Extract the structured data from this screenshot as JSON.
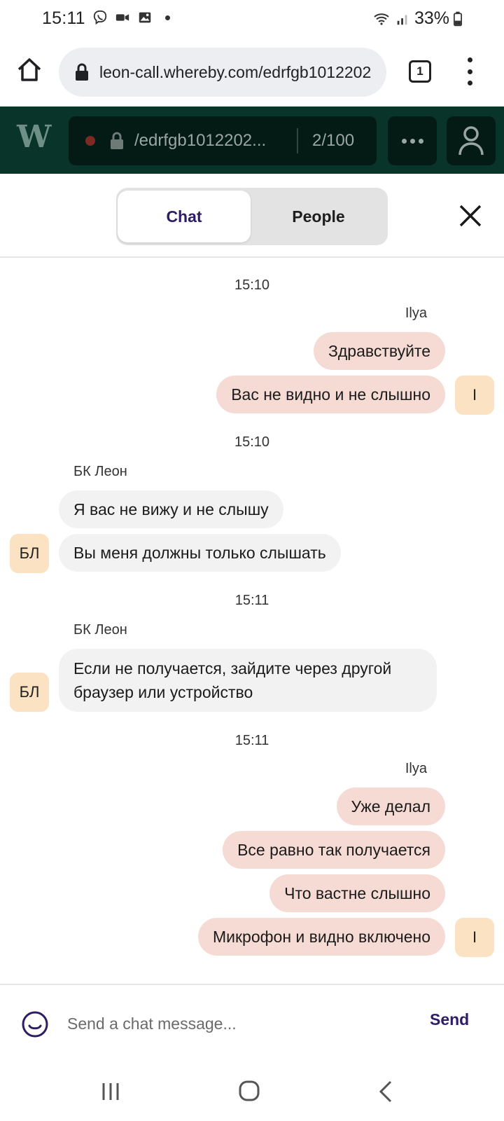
{
  "status_bar": {
    "time": "15:11",
    "icons": [
      "viber-icon",
      "video-icon",
      "image-icon",
      "notification-dot"
    ],
    "battery": "33%"
  },
  "browser": {
    "url": "leon-call.whereby.com/edrfgb1012202",
    "tab_count": "1"
  },
  "app_header": {
    "logo": "W",
    "room_name": "/edrfgb1012202...",
    "participants": "2/100"
  },
  "panel": {
    "tabs": [
      {
        "label": "Chat",
        "active": true
      },
      {
        "label": "People",
        "active": false
      }
    ]
  },
  "chat": {
    "groups": [
      {
        "timestamp": "15:10",
        "sender": "Ilya",
        "own": true,
        "avatar": "I",
        "messages": [
          "Здравствуйте",
          "Вас не видно и не слышно"
        ]
      },
      {
        "timestamp": "15:10",
        "sender": "БК Леон",
        "own": false,
        "avatar": "БЛ",
        "messages": [
          "Я вас не вижу и не слышу",
          "Вы меня должны только слышать"
        ]
      },
      {
        "timestamp": "15:11",
        "sender": "БК Леон",
        "own": false,
        "avatar": "БЛ",
        "messages": [
          "Если не получается,  зайдите через другой браузер или устройство"
        ]
      },
      {
        "timestamp": "15:11",
        "sender": "Ilya",
        "own": true,
        "avatar": "I",
        "messages": [
          "Уже делал",
          "Все равно так получается",
          "Что вастне слышно",
          "Микрофон и видно включено"
        ]
      }
    ]
  },
  "composer": {
    "placeholder": "Send a chat message...",
    "value": "",
    "send_label": "Send"
  },
  "colors": {
    "header_bg": "#08342a",
    "room_pill_bg": "#041b15",
    "own_bubble": "#f6dbd4",
    "other_bubble": "#f2f2f3",
    "avatar_bg": "#fbe2c2",
    "accent": "#2e1c66"
  }
}
